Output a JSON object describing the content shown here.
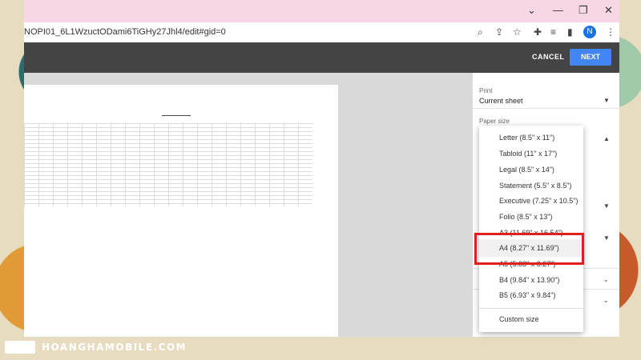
{
  "browser": {
    "url": "NOPI01_6L1WzuctODami6TiGHy27Jhl4/edit#gid=0",
    "avatar_letter": "N",
    "window_controls": {
      "collapse": "⌄",
      "minimize": "—",
      "restore": "❐",
      "close": "✕"
    }
  },
  "print_dialog": {
    "cancel_label": "CANCEL",
    "next_label": "NEXT",
    "print_label": "Print",
    "print_value": "Current sheet",
    "paper_size_label": "Paper size",
    "paper_size_options": [
      "Letter (8.5\" x 11\")",
      "Tabloid (11\" x 17\")",
      "Legal (8.5\" x 14\")",
      "Statement (5.5\" x 8.5\")",
      "Executive (7.25\" x 10.5\")",
      "Folio (8.5\" x 13\")",
      "A3 (11.69\" x 16.54\")",
      "A4 (8.27\" x 11.69\")",
      "A5 (5.83\" x 8.27\")",
      "B4 (9.84\" x 13.90\")",
      "B5 (6.93\" x 9.84\")",
      "Custom size"
    ],
    "highlighted_option": "A4 (8.27\" x 11.69\")"
  },
  "watermark": {
    "brand": "HOANGHAMOBILE.COM"
  },
  "colors": {
    "accent": "#4285f4",
    "highlight": "#e02020",
    "header": "#444444",
    "titlebar": "#f7d7e6"
  }
}
